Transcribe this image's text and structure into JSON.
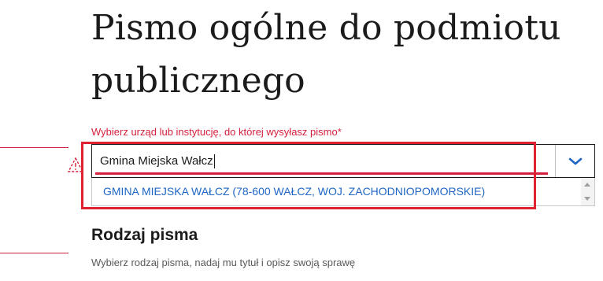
{
  "page": {
    "title": "Pismo ogólne do podmiotu publicznego"
  },
  "recipient_field": {
    "label": "Wybierz urząd lub instytucję, do której wysyłasz pismo*",
    "value": "Gmina Miejska Wałcz",
    "toggle_icon": "chevron-down-icon",
    "suggestions": [
      "GMINA MIEJSKA WAŁCZ (78-600 WAŁCZ, WOJ. ZACHODNIOPOMORSKIE)"
    ]
  },
  "section": {
    "heading": "Rodzaj pisma",
    "description": "Wybierz rodzaj pisma, nadaj mu tytuł i opisz swoją sprawę"
  },
  "colors": {
    "accent_red": "#d4213d",
    "highlight_red": "#e0212f",
    "link_blue": "#1f66c4",
    "text_dark": "#1b1b1b"
  }
}
